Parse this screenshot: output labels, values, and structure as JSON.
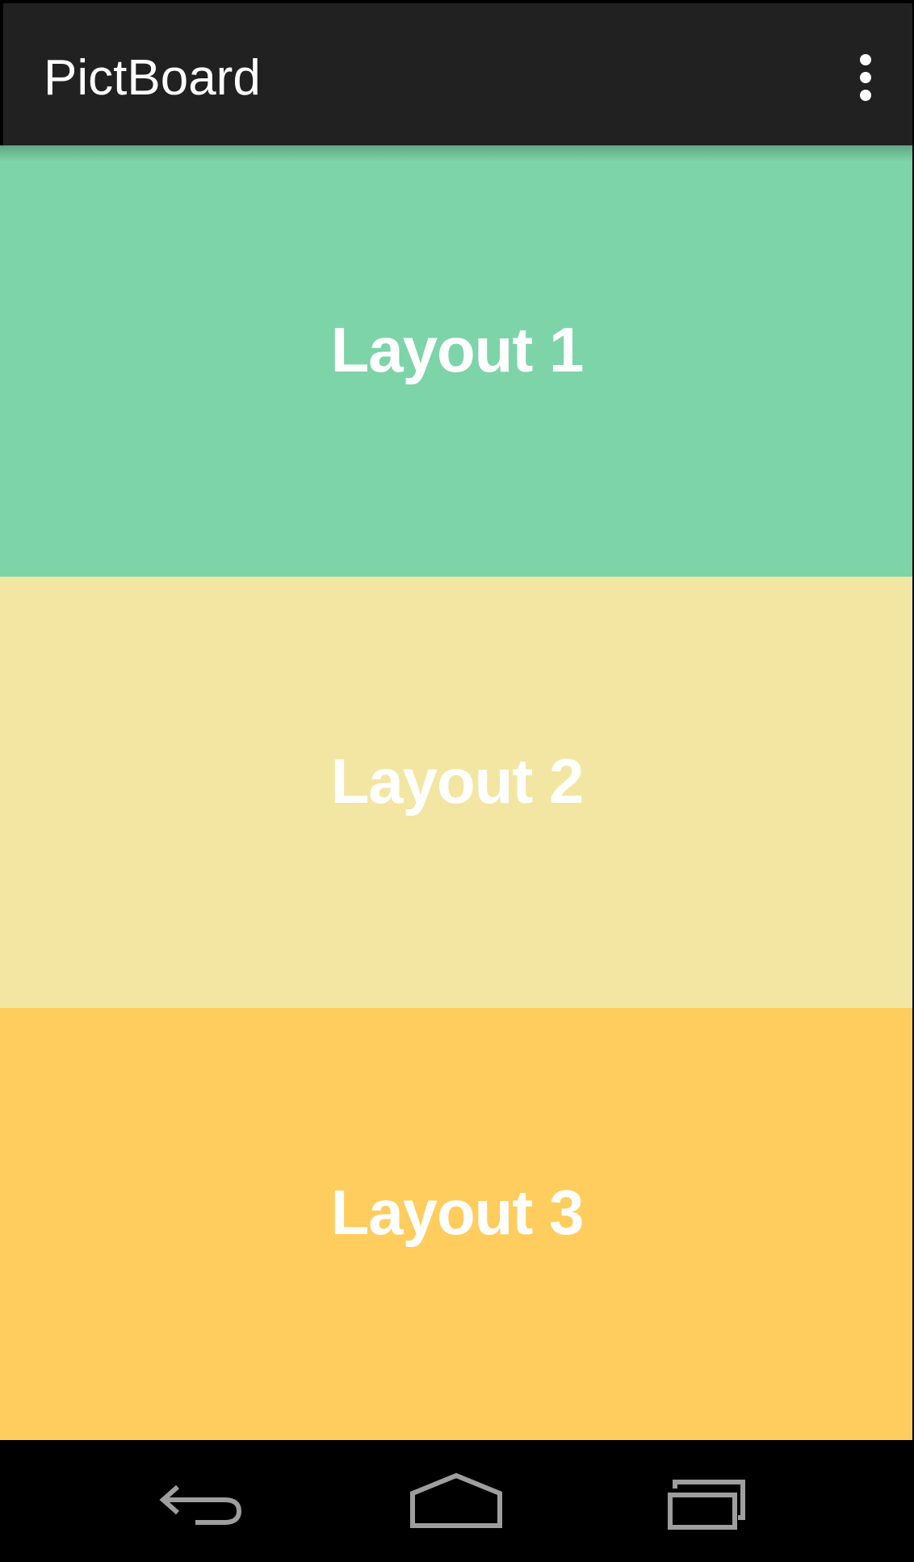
{
  "app_bar": {
    "title": "PictBoard",
    "overflow_icon": "more-vert-icon"
  },
  "layouts": [
    {
      "label": "Layout 1",
      "color": "#7DD4A8"
    },
    {
      "label": "Layout 2",
      "color": "#F2E6A2"
    },
    {
      "label": "Layout 3",
      "color": "#FFCD5E"
    }
  ],
  "nav_bar": {
    "back_icon": "back-icon",
    "home_icon": "home-icon",
    "recents_icon": "recents-icon",
    "icon_color": "#9E9E9E"
  }
}
